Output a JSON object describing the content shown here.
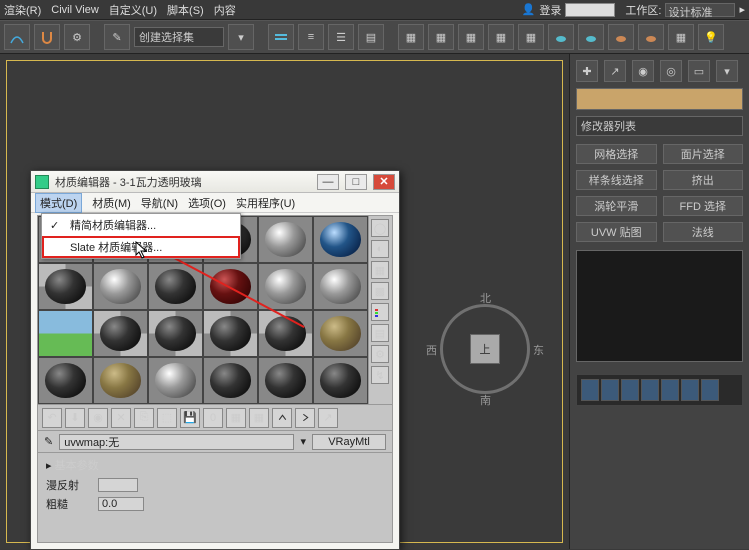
{
  "menubar": {
    "items": [
      "渲染(R)",
      "Civil View",
      "自定义(U)",
      "脚本(S)",
      "内容"
    ],
    "login_label": "登录",
    "login_value": "",
    "workspace_label": "工作区:",
    "workspace_value": "设计标准"
  },
  "toolbar": {
    "combo_label": "创建选择集"
  },
  "gizmo": {
    "n": "北",
    "s": "南",
    "e": "东",
    "w": "西",
    "top": "上"
  },
  "rightpanel": {
    "modlist_label": "修改器列表",
    "buttons": [
      [
        "网格选择",
        "面片选择"
      ],
      [
        "样条线选择",
        "挤出"
      ],
      [
        "涡轮平滑",
        "FFD 选择"
      ],
      [
        "UVW 贴图",
        "法线"
      ]
    ]
  },
  "material_editor": {
    "title": "材质编辑器 - 3-1瓦力透明玻璃",
    "menu": [
      "模式(D)",
      "材质(M)",
      "导航(N)",
      "选项(O)",
      "实用程序(U)"
    ],
    "mode_items": [
      "精简材质编辑器...",
      "Slate 材质编辑器..."
    ],
    "name_field_label": "uvwmap:无",
    "mtl_type": "VRayMtl",
    "params_header": "基本参数",
    "diffuse_label": "漫反射",
    "rough_label": "粗糙",
    "rough_value": "0.0"
  }
}
